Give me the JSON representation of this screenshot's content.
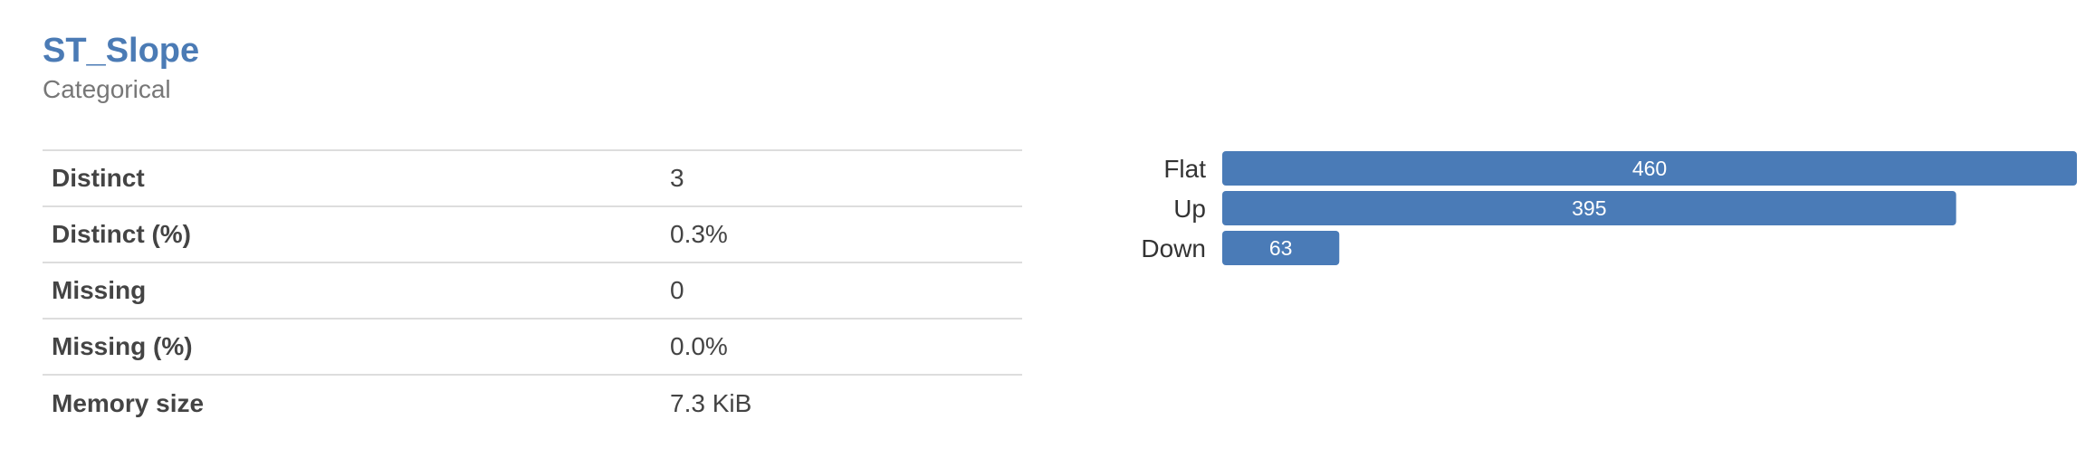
{
  "variable": {
    "name": "ST_Slope",
    "type": "Categorical"
  },
  "stats": [
    {
      "label": "Distinct",
      "value": "3"
    },
    {
      "label": "Distinct (%)",
      "value": "0.3%"
    },
    {
      "label": "Missing",
      "value": "0"
    },
    {
      "label": "Missing (%)",
      "value": "0.0%"
    },
    {
      "label": "Memory size",
      "value": "7.3 KiB"
    }
  ],
  "colors": {
    "accent": "#4b7bb5",
    "bar": "#4a7bb7",
    "bar_text": "#ffffff"
  },
  "chart_data": {
    "type": "bar",
    "orientation": "horizontal",
    "categories": [
      "Flat",
      "Up",
      "Down"
    ],
    "values": [
      460,
      395,
      63
    ],
    "xlim": [
      0,
      460
    ]
  }
}
